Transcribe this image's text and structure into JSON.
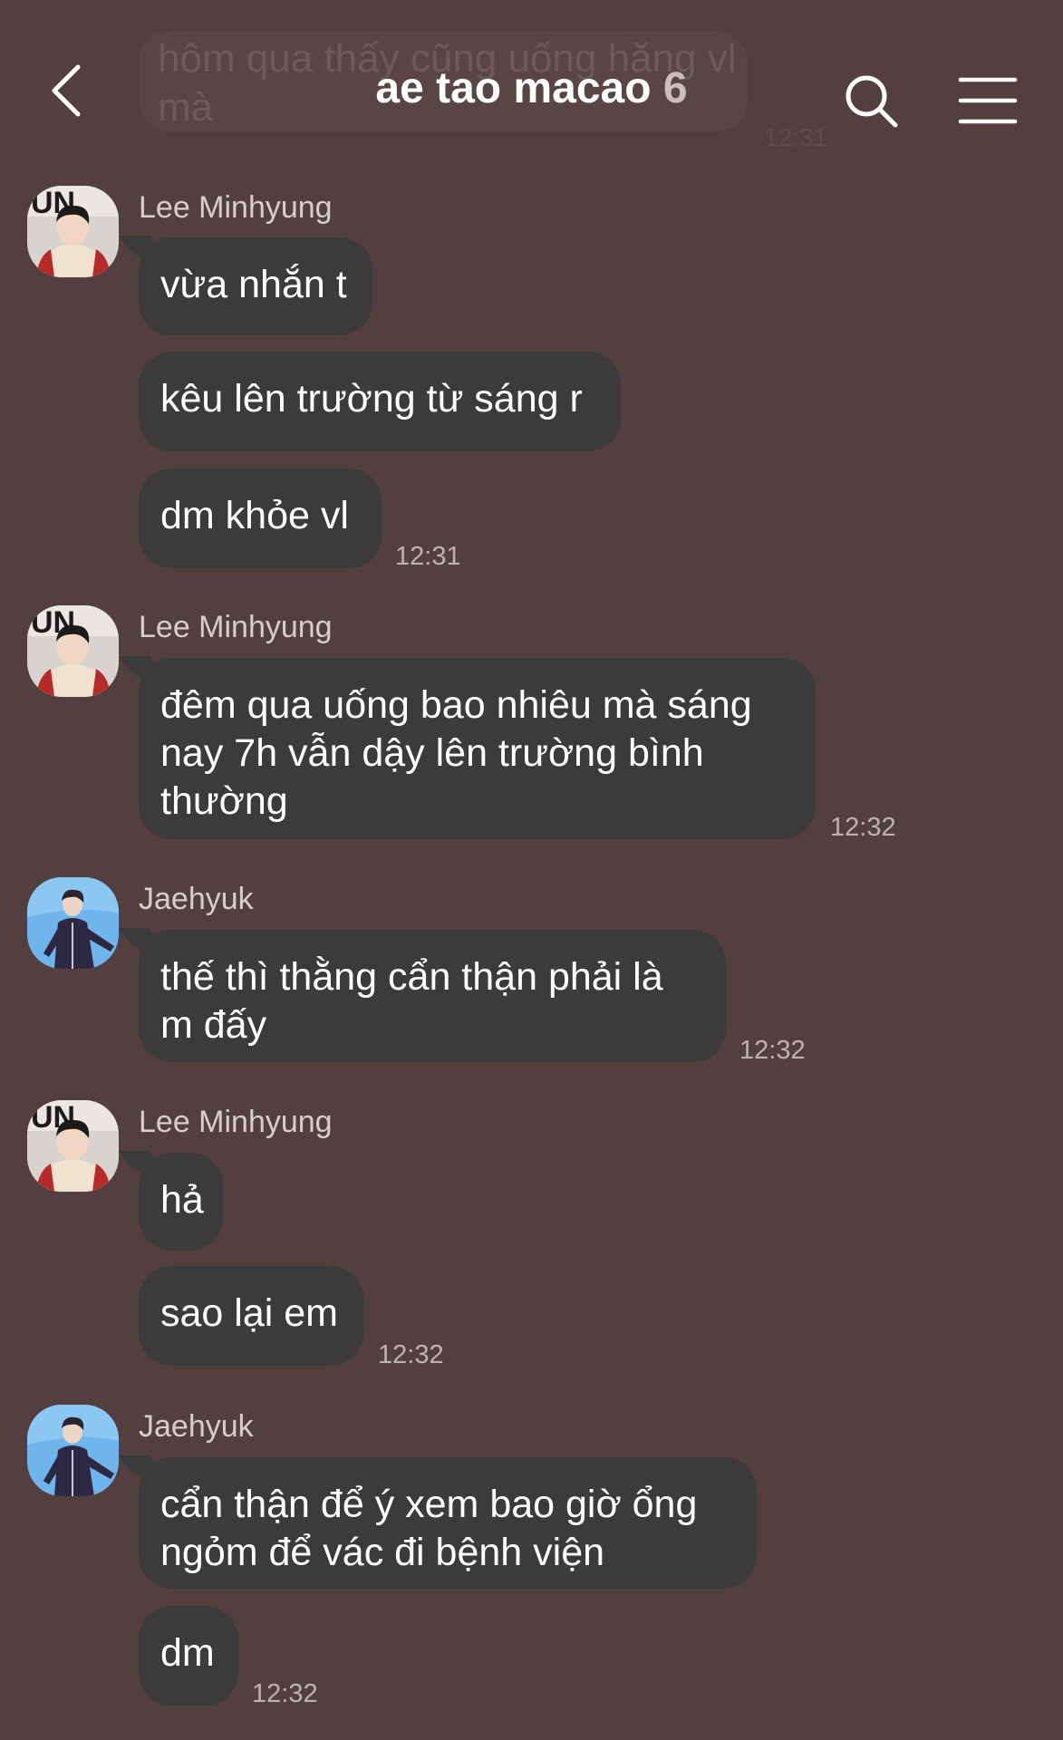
{
  "header": {
    "title": "ae tao macao",
    "member_count": "6"
  },
  "previous_message": {
    "text": "hôm qua thấy cũng uống hăng vl mà",
    "time": "12:31"
  },
  "messages": [
    {
      "sender": "Lee Minhyung",
      "bubbles": [
        "vừa nhắn t",
        "kêu lên trường từ sáng r",
        "dm khỏe vl"
      ],
      "time": "12:31"
    },
    {
      "sender": "Lee Minhyung",
      "bubbles": [
        "đêm qua uống bao nhiêu mà sáng nay 7h vẫn dậy lên trường bình thường"
      ],
      "time": "12:32"
    },
    {
      "sender": "Jaehyuk",
      "bubbles": [
        "thế thì thằng cẩn thận phải là m đấy"
      ],
      "time": "12:32"
    },
    {
      "sender": "Lee Minhyung",
      "bubbles": [
        "hả",
        "sao lại em"
      ],
      "time": "12:32"
    },
    {
      "sender": "Jaehyuk",
      "bubbles": [
        "cẩn thận để ý xem bao giờ ổng ngỏm để vác đi bệnh viện",
        "dm"
      ],
      "time": "12:32"
    }
  ],
  "colors": {
    "background": "#543f40",
    "bubble": "#3d3a3b",
    "text": "#ffffff",
    "timestamp": "#bfb1b1"
  }
}
